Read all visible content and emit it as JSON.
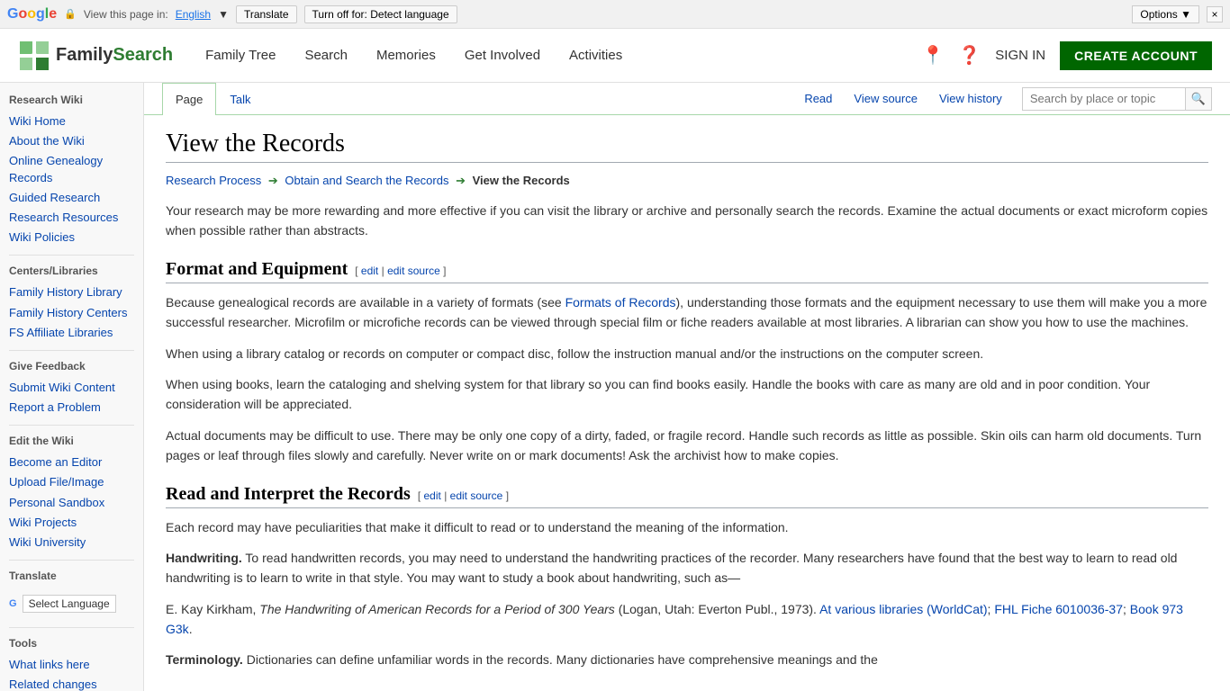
{
  "translate_bar": {
    "view_text": "View this page in:",
    "language": "English",
    "translate_btn": "Translate",
    "turn_off_btn": "Turn off for: Detect language",
    "options_btn": "Options ▼",
    "close_btn": "×"
  },
  "header": {
    "logo_text_family": "Family",
    "logo_text_search": "Search",
    "nav": {
      "family_tree": "Family Tree",
      "search": "Search",
      "memories": "Memories",
      "get_involved": "Get Involved",
      "activities": "Activities"
    },
    "sign_in": "SIGN IN",
    "create_account": "CREATE ACCOUNT"
  },
  "sidebar": {
    "section_research_wiki": "Research Wiki",
    "wiki_home": "Wiki Home",
    "about_wiki": "About the Wiki",
    "online_genealogy": "Online Genealogy Records",
    "guided_research": "Guided Research",
    "research_resources": "Research Resources",
    "wiki_policies": "Wiki Policies",
    "section_centers": "Centers/Libraries",
    "family_history_library": "Family History Library",
    "family_history_centers": "Family History Centers",
    "fs_affiliate": "FS Affiliate Libraries",
    "section_feedback": "Give Feedback",
    "submit_wiki": "Submit Wiki Content",
    "report_problem": "Report a Problem",
    "section_edit": "Edit the Wiki",
    "become_editor": "Become an Editor",
    "upload_file": "Upload File/Image",
    "personal_sandbox": "Personal Sandbox",
    "wiki_projects": "Wiki Projects",
    "wiki_university": "Wiki University",
    "section_translate": "Translate",
    "select_language": "Select Language",
    "section_tools": "Tools",
    "what_links": "What links here",
    "related_changes": "Related changes"
  },
  "page_tabs": {
    "page": "Page",
    "talk": "Talk",
    "read": "Read",
    "view_source": "View source",
    "view_history": "View history",
    "search_placeholder": "Search by place or topic"
  },
  "article": {
    "title": "View the Records",
    "breadcrumb": {
      "research_process": "Research Process",
      "obtain_search": "Obtain and Search the Records",
      "current": "View the Records"
    },
    "intro": "Your research may be more rewarding and more effective if you can visit the library or archive and personally search the records. Examine the actual documents or exact microform copies when possible rather than abstracts.",
    "section1": {
      "title": "Format and Equipment",
      "edit": "edit",
      "edit_source": "edit source",
      "para1": "Because genealogical records are available in a variety of formats (see Formats of Records), understanding those formats and the equipment necessary to use them will make you a more successful researcher. Microfilm or microfiche records can be viewed through special film or fiche readers available at most libraries. A librarian can show you how to use the machines.",
      "para2": "When using a library catalog or records on computer or compact disc, follow the instruction manual and/or the instructions on the computer screen.",
      "para3": "When using books, learn the cataloging and shelving system for that library so you can find books easily. Handle the books with care as many are old and in poor condition. Your consideration will be appreciated.",
      "para4": "Actual documents may be difficult to use. There may be only one copy of a dirty, faded, or fragile record. Handle such records as little as possible. Skin oils can harm old documents. Turn pages or leaf through files slowly and carefully. Never write on or mark documents! Ask the archivist how to make copies."
    },
    "section2": {
      "title": "Read and Interpret the Records",
      "edit": "edit",
      "edit_source": "edit source",
      "para1": "Each record may have peculiarities that make it difficult to read or to understand the meaning of the information.",
      "handwriting_label": "Handwriting.",
      "handwriting_text": " To read handwritten records, you may need to understand the handwriting practices of the recorder. Many researchers have found that the best way to learn to read old handwriting is to learn to write in that style. You may want to study a book about handwriting, such as—",
      "book_ref": "E. Kay Kirkham, ",
      "book_title": "The Handwriting of American Records for a Period of 300 Years",
      "book_details": " (Logan, Utah: Everton Publ., 1973). ",
      "worldcat_link": "At various libraries (WorldCat)",
      "fhl_link": "FHL Fiche 6010036-37",
      "book_link": "Book 973 G3k",
      "terminology_label": "Terminology."
    }
  }
}
